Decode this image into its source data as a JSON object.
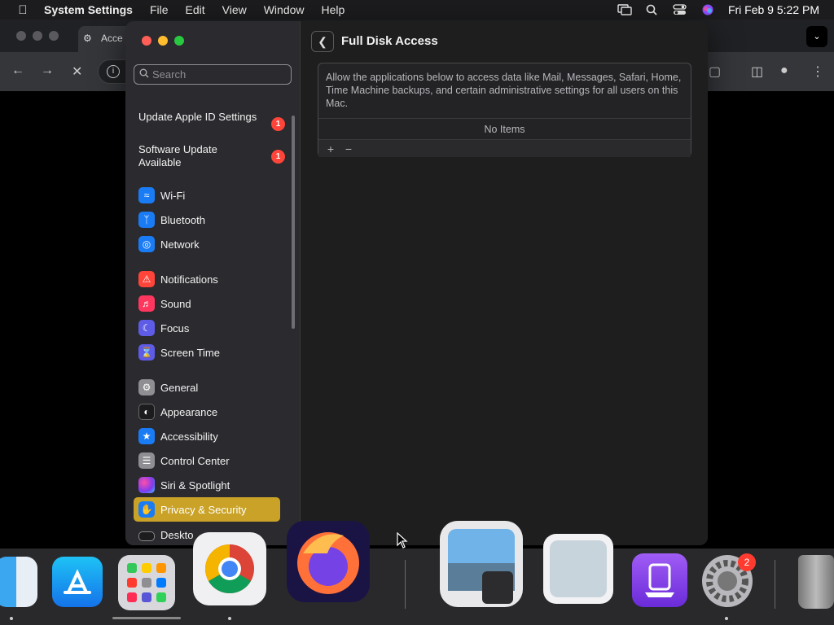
{
  "menubar": {
    "app_name": "System Settings",
    "menus": [
      "File",
      "Edit",
      "View",
      "Window",
      "Help"
    ],
    "datetime": "Fri Feb 9  5:22 PM"
  },
  "browser": {
    "tab_title": "Acce"
  },
  "sidebar": {
    "search_placeholder": "Search",
    "alerts": [
      {
        "label": "Update Apple ID Settings",
        "badge": "1"
      },
      {
        "label": "Software Update Available",
        "badge": "1"
      }
    ],
    "groups": [
      [
        {
          "label": "Wi-Fi",
          "icon": "wifi-icon",
          "color": "#1a7cf5"
        },
        {
          "label": "Bluetooth",
          "icon": "bluetooth-icon",
          "color": "#1a7cf5"
        },
        {
          "label": "Network",
          "icon": "globe-icon",
          "color": "#1a7cf5"
        }
      ],
      [
        {
          "label": "Notifications",
          "icon": "bell-icon",
          "color": "#ff453a"
        },
        {
          "label": "Sound",
          "icon": "speaker-icon",
          "color": "#ff375f"
        },
        {
          "label": "Focus",
          "icon": "moon-icon",
          "color": "#5e5ce6"
        },
        {
          "label": "Screen Time",
          "icon": "hourglass-icon",
          "color": "#5e5ce6"
        }
      ],
      [
        {
          "label": "General",
          "icon": "gear-icon",
          "color": "#8e8e93"
        },
        {
          "label": "Appearance",
          "icon": "appearance-icon",
          "color": "#1c1c1e"
        },
        {
          "label": "Accessibility",
          "icon": "accessibility-icon",
          "color": "#1a7cf5"
        },
        {
          "label": "Control Center",
          "icon": "toggles-icon",
          "color": "#8e8e93"
        },
        {
          "label": "Siri & Spotlight",
          "icon": "siri-icon",
          "color": "#7d3cf0"
        },
        {
          "label": "Privacy & Security",
          "icon": "hand-icon",
          "color": "#1a7cf5",
          "selected": true
        }
      ]
    ],
    "partial_item": "Deskto"
  },
  "content": {
    "title": "Full Disk Access",
    "description": "Allow the applications below to access data like Mail, Messages, Safari, Home, Time Machine backups, and certain administrative settings for all users on this Mac.",
    "empty_label": "No Items",
    "add_label": "+",
    "remove_label": "−"
  },
  "dock": {
    "items": [
      "finder-icon",
      "app-store-icon",
      "launchpad-icon",
      "chrome-icon",
      "firefox-icon",
      "preview-icon",
      "screenshot-icon",
      "simulator-icon",
      "system-settings-icon",
      "trash-icon"
    ],
    "settings_badge": "2"
  }
}
